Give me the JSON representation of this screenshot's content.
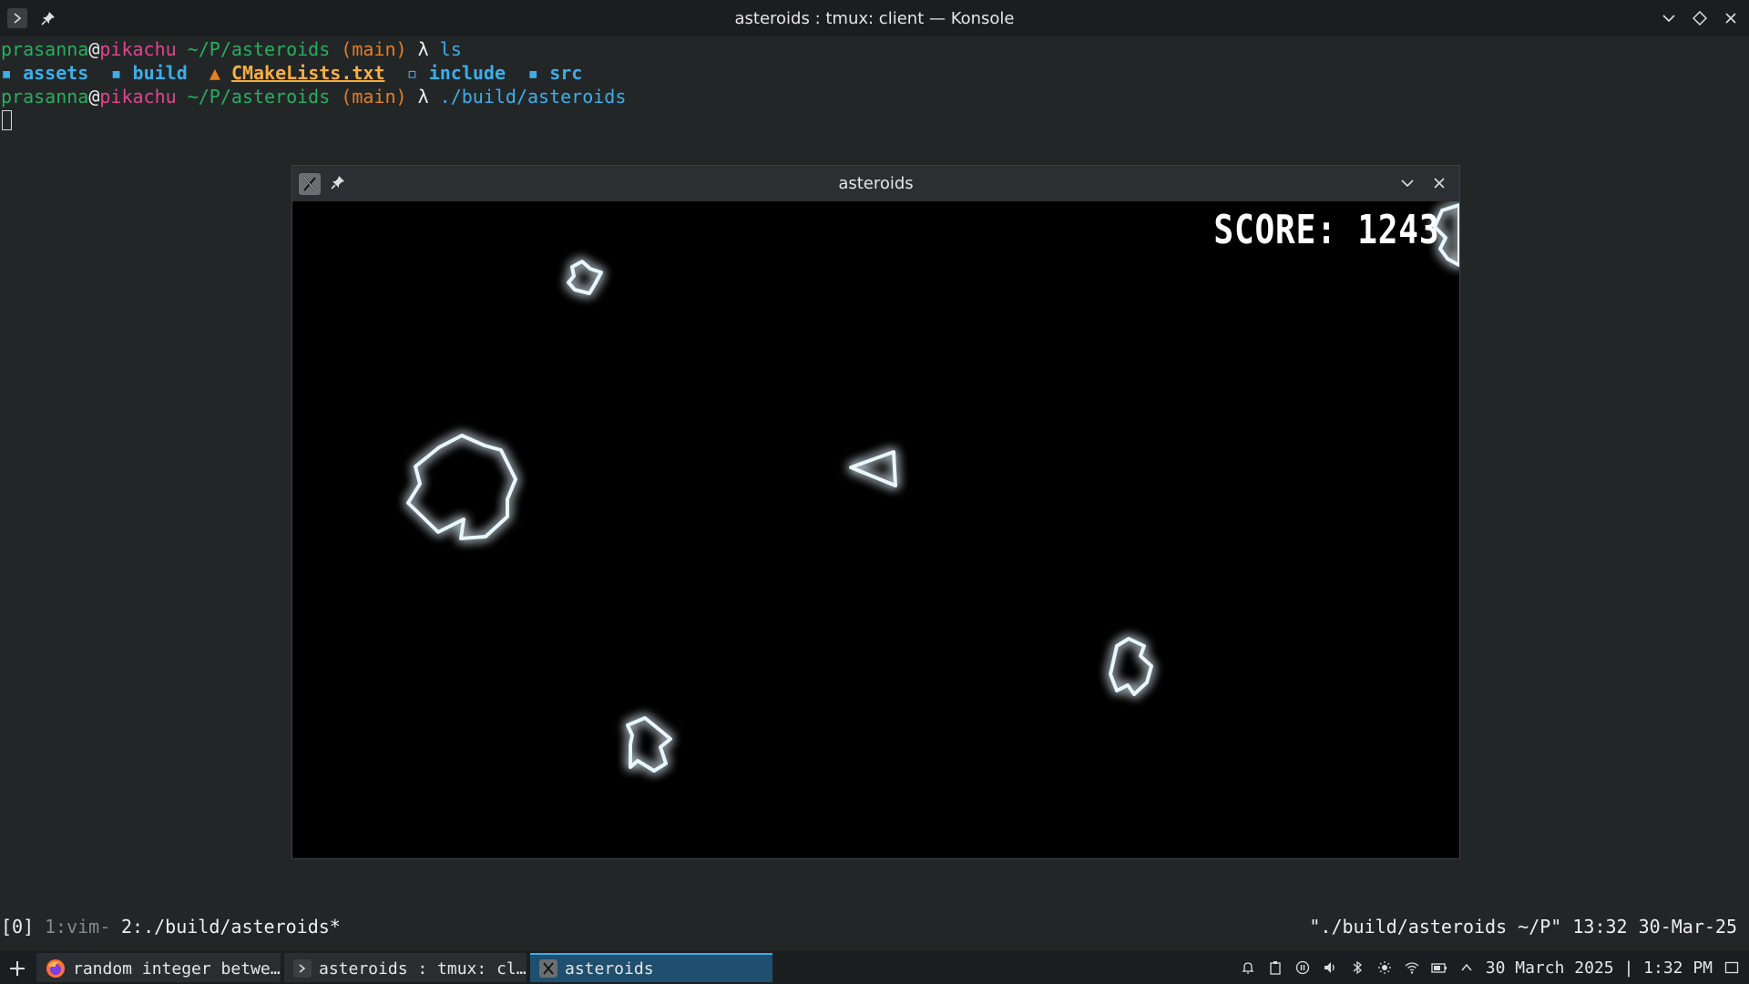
{
  "window": {
    "title": "asteroids : tmux: client — Konsole"
  },
  "terminal": {
    "prompt": {
      "user": "prasanna",
      "at": "@",
      "host": "pikachu",
      "path": " ~/P/asteroids",
      "branch": " (main)",
      "lambda": " λ "
    },
    "cmd1": "ls",
    "ls_items": [
      {
        "name": "assets",
        "kind": "folder"
      },
      {
        "name": "build",
        "kind": "folder"
      },
      {
        "name": "CMakeLists.txt",
        "kind": "cmake-file"
      },
      {
        "name": "include",
        "kind": "folder-link"
      },
      {
        "name": "src",
        "kind": "folder"
      }
    ],
    "cmd2": "./build/asteroids"
  },
  "game_window": {
    "title": "asteroids",
    "score_text": "SCORE: 1243"
  },
  "tmux": {
    "session": "[0]",
    "window1": "1:vim-",
    "window2": "2:./build/asteroids*",
    "right": "\"./build/asteroids ~/P\" 13:32 30-Mar-25"
  },
  "taskbar": {
    "tasks": [
      {
        "label": "random integer betwe…",
        "icon": "firefox-icon"
      },
      {
        "label": "asteroids : tmux: cl…",
        "icon": "konsole-icon"
      },
      {
        "label": "asteroids",
        "icon": "x11-app-icon"
      }
    ],
    "clock": "30 March 2025 | 1:32 PM"
  },
  "colors": {
    "terminal_bg": "#232627",
    "accent": "#3daee9",
    "prompt_user": "#27ae60",
    "prompt_host": "#e0458f",
    "prompt_branch": "#e67e22",
    "game_bg": "#000000",
    "asteroid_glow": "#bfe9ff"
  }
}
